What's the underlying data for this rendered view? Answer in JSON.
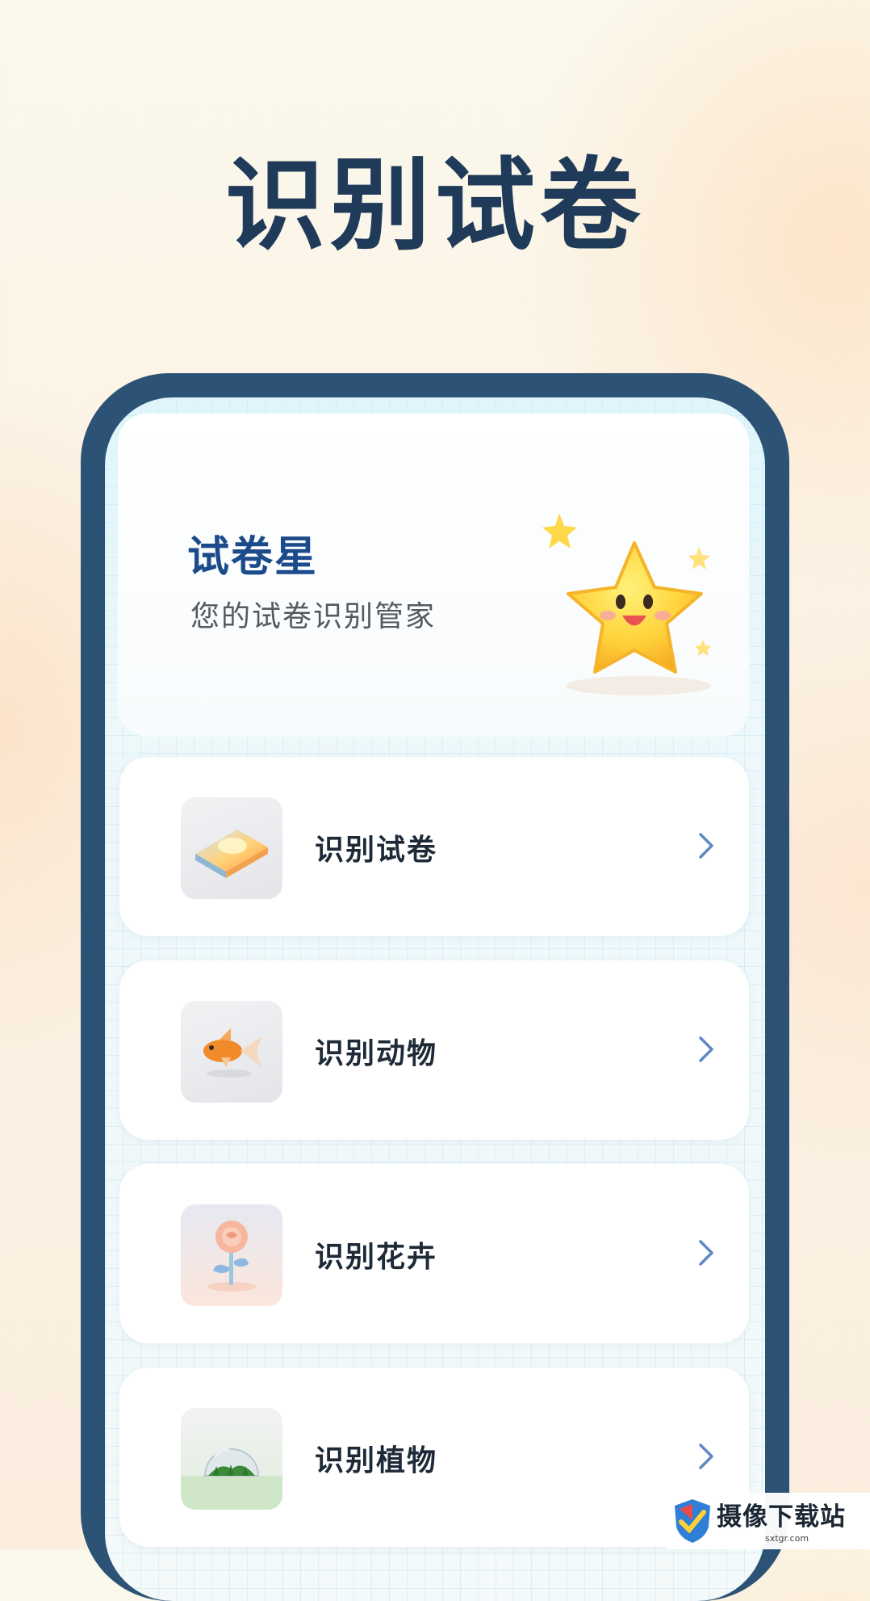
{
  "hero": {
    "title": "识别试卷"
  },
  "app": {
    "name": "试卷星",
    "slogan": "您的试卷识别管家"
  },
  "menu": [
    {
      "label": "识别试卷",
      "icon": "book-icon"
    },
    {
      "label": "识别动物",
      "icon": "goldfish-icon"
    },
    {
      "label": "识别花卉",
      "icon": "rose-icon"
    },
    {
      "label": "识别植物",
      "icon": "terrarium-icon"
    }
  ],
  "watermark": {
    "name": "摄像下载站",
    "url": "sxtgr.com"
  },
  "colors": {
    "frame": "#2c5375",
    "title": "#1f3b59",
    "accent": "#1c4b8c",
    "chevron": "#5f88c4"
  }
}
